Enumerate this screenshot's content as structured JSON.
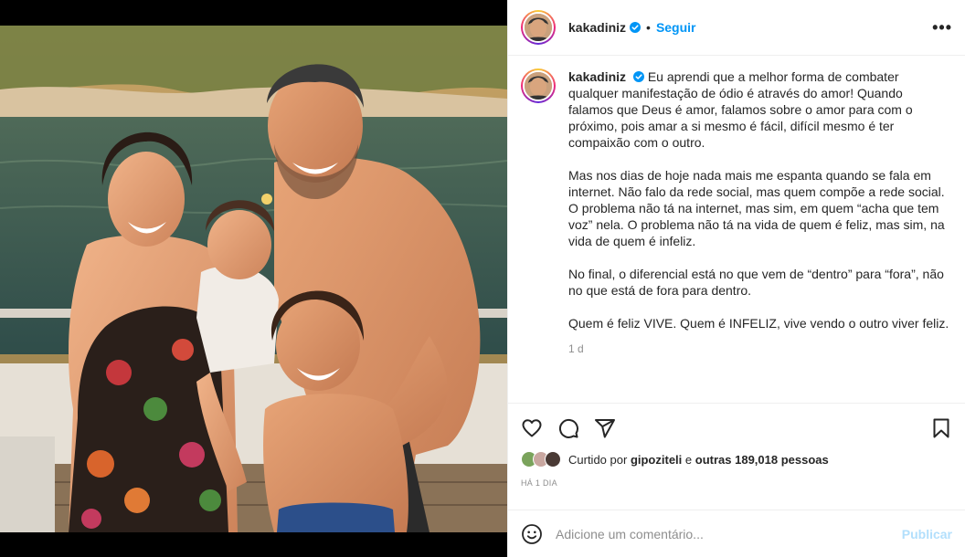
{
  "post": {
    "username": "kakadiniz",
    "follow_label": "Seguir",
    "separator": "•",
    "more_label": "•••",
    "caption": {
      "username": "kakadiniz",
      "paragraphs": [
        "Eu aprendi que a melhor forma de combater qualquer manifestação de ódio é através do amor! Quando falamos que Deus é amor, falamos sobre o amor para com o próximo, pois amar a si mesmo é fácil, difícil mesmo é ter compaixão com o outro.",
        "Mas nos dias de hoje nada mais me espanta quando se fala em internet. Não falo da rede social, mas quem compõe a rede social. O problema não tá na internet, mas sim, em quem “acha que tem voz” nela. O problema não tá na vida de quem é feliz, mas sim, na vida de quem é infeliz.",
        "No final, o diferencial está no que vem de “dentro” para “fora”, não no que está de fora para dentro.",
        "Quem é feliz VIVE. Quem é INFELIZ, vive vendo o outro viver feliz."
      ],
      "time_ago": "1 d"
    },
    "likes": {
      "prefix": "Curtido por",
      "user": "gipoziteli",
      "connector": "e",
      "others": "outras 189,018 pessoas"
    },
    "date": "HÁ 1 DIA",
    "comment": {
      "placeholder": "Adicione um comentário...",
      "publish_label": "Publicar"
    }
  },
  "icons": {
    "verified": "verified-badge-icon",
    "like": "heart-icon",
    "comment": "comment-bubble-icon",
    "share": "paper-plane-icon",
    "save": "bookmark-icon",
    "emoji": "emoji-smile-icon"
  },
  "colors": {
    "accent": "#0095f6",
    "publish_disabled": "#b2dffc",
    "muted": "#8e8e8e",
    "text": "#262626",
    "border": "#efefef"
  }
}
